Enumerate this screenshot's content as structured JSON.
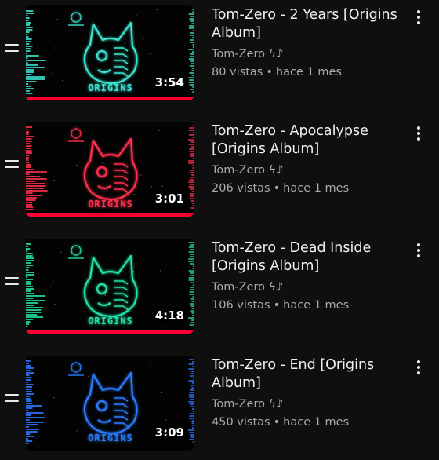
{
  "videos": [
    {
      "title": "Tom-Zero - 2 Years [Origins Album]",
      "channel": "Tom-Zero ϟ♪",
      "views": "80 vistas",
      "age": "hace 1 mes",
      "duration": "3:54",
      "watched_fraction": 1.0,
      "color": "#3ce2d0",
      "thumb_text": "ORIGINS",
      "icon": "neon-cat-icon"
    },
    {
      "title": "Tom-Zero - Apocalypse [Origins Album]",
      "channel": "Tom-Zero ϟ♪",
      "views": "206 vistas",
      "age": "hace 1 mes",
      "duration": "3:01",
      "watched_fraction": 1.0,
      "color": "#ff2f4e",
      "thumb_text": "ORIGINS",
      "icon": "neon-cat-icon"
    },
    {
      "title": "Tom-Zero - Dead Inside [Origins Album]",
      "channel": "Tom-Zero ϟ♪",
      "views": "106 vistas",
      "age": "hace 1 mes",
      "duration": "4:18",
      "watched_fraction": 1.0,
      "color": "#24e0a6",
      "thumb_text": "ORIGINS",
      "icon": "neon-cat-icon"
    },
    {
      "title": "Tom-Zero - End [Origins Album]",
      "channel": "Tom-Zero ϟ♪",
      "views": "450 vistas",
      "age": "hace 1 mes",
      "duration": "3:09",
      "watched_fraction": 0,
      "color": "#2b7bff",
      "thumb_text": "ORIGINS",
      "icon": "neon-cat-icon"
    }
  ],
  "colors": {
    "background": "#0f0f0f",
    "progress": "#ff0033",
    "secondary_text": "#aaaaaa"
  }
}
